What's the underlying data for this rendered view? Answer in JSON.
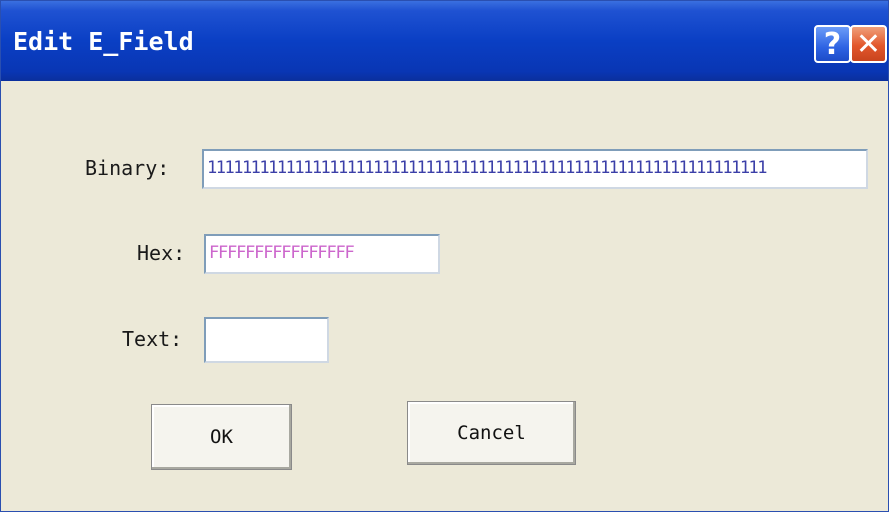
{
  "window": {
    "title": "Edit E_Field",
    "help_glyph": "?",
    "close_glyph": "✕"
  },
  "form": {
    "binary_label": "Binary:",
    "binary_value": "1111111111111111111111111111111111111111111111111111111111111111",
    "hex_label": "Hex:",
    "hex_value": "FFFFFFFFFFFFFFFF",
    "text_label": "Text:",
    "text_value": ""
  },
  "buttons": {
    "ok_label": "OK",
    "cancel_label": "Cancel"
  },
  "colors": {
    "titlebar": "#0a3fc4",
    "dialog_bg": "#ece9d8",
    "binary_text": "#3b3fa8",
    "hex_text": "#cc66cc",
    "close_button": "#e2572c"
  }
}
